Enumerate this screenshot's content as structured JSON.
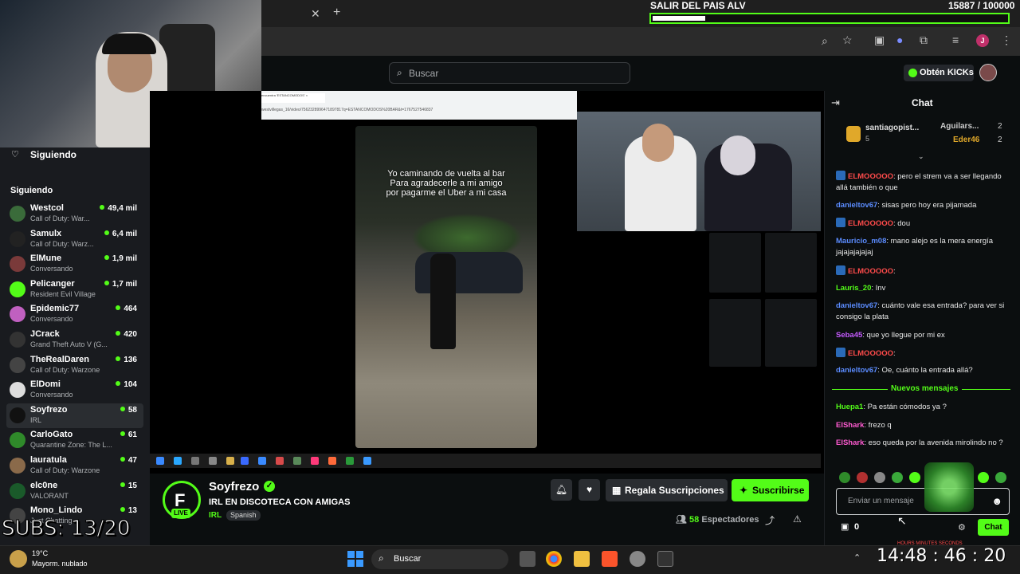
{
  "subs_goal": {
    "title": "SALIR DEL PAIS ALV",
    "count": "15887 / 100000",
    "progress": 0.1589
  },
  "browser": {
    "close_tab": "✕",
    "new_tab": "+",
    "icons": [
      "search-icon",
      "star-icon",
      "reader-icon",
      "extension-icon",
      "puzzle-icon",
      "cast-icon",
      "profile-icon",
      "menu-icon"
    ],
    "profile_initial": "J"
  },
  "kick": {
    "search_placeholder": "Buscar",
    "kicks_button": "Obtén KICKs"
  },
  "sidebar": {
    "top_label": "Siguiendo",
    "section_label": "Siguiendo",
    "channels": [
      {
        "name": "Westcol",
        "game": "Call of Duty: War...",
        "viewers": "49,4 mil",
        "color": "#3a6b3a"
      },
      {
        "name": "Samulx",
        "game": "Call of Duty: Warz...",
        "viewers": "6,4 mil",
        "color": "#222"
      },
      {
        "name": "ElMune",
        "game": "Conversando",
        "viewers": "1,9 mil",
        "color": "#7a3a3a"
      },
      {
        "name": "Pelicanger",
        "game": "Resident Evil Village",
        "viewers": "1,7 mil",
        "color": "#53fc18"
      },
      {
        "name": "Epidemic77",
        "game": "Conversando",
        "viewers": "464",
        "color": "#c060c0"
      },
      {
        "name": "JCrack",
        "game": "Grand Theft Auto V (G...",
        "viewers": "420",
        "color": "#333"
      },
      {
        "name": "TheRealDaren",
        "game": "Call of Duty: Warzone",
        "viewers": "136",
        "color": "#444"
      },
      {
        "name": "ElDomi",
        "game": "Conversando",
        "viewers": "104",
        "color": "#ddd"
      },
      {
        "name": "Soyfrezo",
        "game": "IRL",
        "viewers": "58",
        "color": "#111"
      },
      {
        "name": "CarloGato",
        "game": "Quarantine Zone: The L...",
        "viewers": "61",
        "color": "#2f8a2a"
      },
      {
        "name": "lauratula",
        "game": "Call of Duty: Warzone",
        "viewers": "47",
        "color": "#8a6a4a"
      },
      {
        "name": "elc0ne",
        "game": "VALORANT",
        "viewers": "15",
        "color": "#1a5a2a"
      },
      {
        "name": "Mono_Lindo",
        "game": "Just Chatting",
        "viewers": "13",
        "color": "#444"
      }
    ]
  },
  "video": {
    "caption_line1": "Yo caminando de vuelta al bar",
    "caption_line2": "Para agradecerle a mi amigo",
    "caption_line3": "por pagarme el Uber a mi casa",
    "overlay_tab": "encuentra 'ESTANCOMODOS' ×",
    "overlay_url": "westvillegas_16/video/7562328996471897817q=ESTANCOMODOS%20BAR&t=1767527546837"
  },
  "stream": {
    "channel": "Soyfrezo",
    "live": "LIVE",
    "title": "IRL EN DISCOTECA CON AMIGAS",
    "category": "IRL",
    "language": "Spanish",
    "gift_label": "Regala Suscripciones",
    "subscribe_label": "Suscribirse",
    "viewers": "58",
    "viewers_label": "Espectadores"
  },
  "chat": {
    "title": "Chat",
    "pinned": {
      "user": "santiagopist...",
      "count": "5",
      "gifters": [
        {
          "name": "Aguilars...",
          "n": "2"
        },
        {
          "name": "Eder46",
          "n": "2"
        }
      ]
    },
    "messages": [
      {
        "user": "ELMOOOOO",
        "text": ": pero el strem va a ser llegando allá también o que",
        "color": "#ff4b4b",
        "badge": true
      },
      {
        "user": "danieltov67",
        "text": ": sisas pero hoy era pijamada",
        "color": "#5b8cff",
        "badge": false
      },
      {
        "user": "ELMOOOOO",
        "text": ": dou",
        "color": "#ff4b4b",
        "badge": true
      },
      {
        "user": "Mauricio_m08",
        "text": ": mano alejo es la mera energía jajajajajajaj",
        "color": "#5b8cff",
        "badge": false
      },
      {
        "user": "ELMOOOOO",
        "text": ":",
        "color": "#ff4b4b",
        "badge": true
      },
      {
        "user": "Lauris_20",
        "text": ": Inv",
        "color": "#53fc18",
        "badge": false
      },
      {
        "user": "danieltov67",
        "text": ": cuánto vale esa entrada? para ver si consigo la plata",
        "color": "#5b8cff",
        "badge": false
      },
      {
        "user": "Seba45",
        "text": ": que yo llegue por mi ex",
        "color": "#c65bff",
        "badge": false
      },
      {
        "user": "ELMOOOOO",
        "text": ":",
        "color": "#ff4b4b",
        "badge": true
      },
      {
        "user": "danieltov67",
        "text": ": Oe, cuánto la entrada allá?",
        "color": "#5b8cff",
        "badge": false
      },
      {
        "user": "Huepa1",
        "text": ": Pa están cómodos ya ?",
        "color": "#53fc18",
        "badge": false
      },
      {
        "user": "ElShark",
        "text": ": frezo q",
        "color": "#ff5bd1",
        "badge": false
      },
      {
        "user": "ElShark",
        "text": ": eso queda por la avenida mirolindo no ?",
        "color": "#ff5bd1",
        "badge": false
      }
    ],
    "new_messages": "Nuevos mensajes",
    "input_placeholder": "Enviar un mensaje",
    "kicks": "0",
    "send": "Chat"
  },
  "subs_overlay": "SUBS: 13/20",
  "taskbar": {
    "temp": "19°C",
    "weather": "Mayorm. nublado",
    "search": "Buscar",
    "clock": "14:48 : 46 : 20",
    "clock_labels": "HOURS   MINUTES   SECONDS"
  }
}
